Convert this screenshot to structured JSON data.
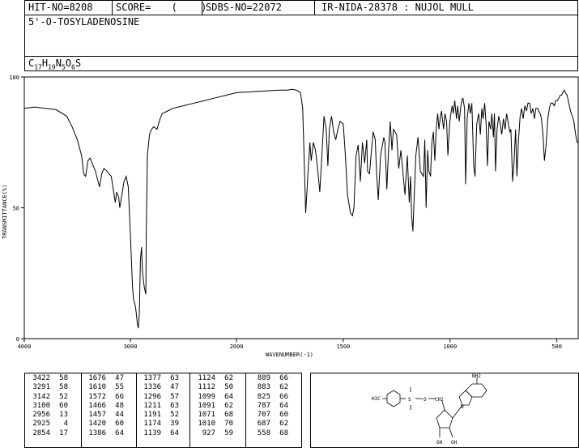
{
  "header": {
    "hit_no": "HIT-NO=8208",
    "score": "SCORE=  (  )",
    "sdbs_no": "SDBS-NO=22072",
    "ir_info": "IR-NIDA-28378 : NUJOL MULL",
    "compound_name": "5'-O-TOSYLADENOSINE",
    "formula": "C17H19N5O6S"
  },
  "chart_data": {
    "type": "line",
    "title": "",
    "xlabel": "WAVENUMBER(-1)",
    "ylabel": "TRANSMITTANCE(%)",
    "xlim": [
      4000,
      400
    ],
    "ylim": [
      0,
      100
    ],
    "x_ticks": [
      4000,
      3000,
      2000,
      1500,
      1000,
      500
    ],
    "y_ticks": [
      0,
      50,
      100
    ],
    "series": [
      {
        "points": [
          [
            4000,
            88
          ],
          [
            3900,
            88.5
          ],
          [
            3800,
            88
          ],
          [
            3700,
            87.5
          ],
          [
            3600,
            85
          ],
          [
            3550,
            81
          ],
          [
            3500,
            76
          ],
          [
            3460,
            70
          ],
          [
            3440,
            63
          ],
          [
            3422,
            62
          ],
          [
            3400,
            68
          ],
          [
            3380,
            69
          ],
          [
            3360,
            67
          ],
          [
            3330,
            64
          ],
          [
            3291,
            58
          ],
          [
            3270,
            63
          ],
          [
            3250,
            65
          ],
          [
            3220,
            64
          ],
          [
            3180,
            62
          ],
          [
            3142,
            52
          ],
          [
            3130,
            56
          ],
          [
            3110,
            54
          ],
          [
            3100,
            50
          ],
          [
            3080,
            55
          ],
          [
            3060,
            60
          ],
          [
            3040,
            62
          ],
          [
            3020,
            58
          ],
          [
            3000,
            40
          ],
          [
            2980,
            20
          ],
          [
            2970,
            15
          ],
          [
            2956,
            13
          ],
          [
            2945,
            10
          ],
          [
            2935,
            6
          ],
          [
            2925,
            4
          ],
          [
            2915,
            10
          ],
          [
            2905,
            30
          ],
          [
            2895,
            35
          ],
          [
            2885,
            25
          ],
          [
            2870,
            20
          ],
          [
            2860,
            18
          ],
          [
            2854,
            17
          ],
          [
            2850,
            40
          ],
          [
            2840,
            70
          ],
          [
            2820,
            78
          ],
          [
            2800,
            80
          ],
          [
            2780,
            81
          ],
          [
            2750,
            80
          ],
          [
            2720,
            84
          ],
          [
            2700,
            86
          ],
          [
            2650,
            87
          ],
          [
            2600,
            88
          ],
          [
            2500,
            89
          ],
          [
            2400,
            90
          ],
          [
            2300,
            91
          ],
          [
            2200,
            92
          ],
          [
            2100,
            93
          ],
          [
            2000,
            94
          ],
          [
            1900,
            94.5
          ],
          [
            1800,
            95
          ],
          [
            1760,
            95
          ],
          [
            1740,
            95.3
          ],
          [
            1720,
            95
          ],
          [
            1700,
            94
          ],
          [
            1690,
            88
          ],
          [
            1676,
            48
          ],
          [
            1666,
            62
          ],
          [
            1656,
            75
          ],
          [
            1650,
            68
          ],
          [
            1640,
            75
          ],
          [
            1630,
            72
          ],
          [
            1620,
            65
          ],
          [
            1610,
            56
          ],
          [
            1600,
            70
          ],
          [
            1590,
            85
          ],
          [
            1580,
            80
          ],
          [
            1572,
            66
          ],
          [
            1565,
            80
          ],
          [
            1555,
            85
          ],
          [
            1545,
            79
          ],
          [
            1535,
            76
          ],
          [
            1525,
            80
          ],
          [
            1515,
            83
          ],
          [
            1500,
            82
          ],
          [
            1490,
            70
          ],
          [
            1480,
            55
          ],
          [
            1466,
            48
          ],
          [
            1457,
            47
          ],
          [
            1450,
            50
          ],
          [
            1440,
            70
          ],
          [
            1430,
            74
          ],
          [
            1420,
            60
          ],
          [
            1410,
            75
          ],
          [
            1400,
            67
          ],
          [
            1390,
            76
          ],
          [
            1386,
            64
          ],
          [
            1377,
            63
          ],
          [
            1370,
            70
          ],
          [
            1360,
            79
          ],
          [
            1350,
            76
          ],
          [
            1345,
            65
          ],
          [
            1336,
            53
          ],
          [
            1325,
            70
          ],
          [
            1310,
            77
          ],
          [
            1305,
            75
          ],
          [
            1296,
            57
          ],
          [
            1288,
            72
          ],
          [
            1280,
            83
          ],
          [
            1272,
            72
          ],
          [
            1265,
            80
          ],
          [
            1250,
            78
          ],
          [
            1240,
            65
          ],
          [
            1230,
            72
          ],
          [
            1220,
            63
          ],
          [
            1211,
            55
          ],
          [
            1200,
            70
          ],
          [
            1191,
            52
          ],
          [
            1185,
            62
          ],
          [
            1180,
            47
          ],
          [
            1174,
            41
          ],
          [
            1165,
            60
          ],
          [
            1160,
            70
          ],
          [
            1150,
            77
          ],
          [
            1139,
            64
          ],
          [
            1124,
            62
          ],
          [
            1118,
            76
          ],
          [
            1112,
            50
          ],
          [
            1105,
            72
          ],
          [
            1099,
            64
          ],
          [
            1091,
            62
          ],
          [
            1085,
            75
          ],
          [
            1078,
            79
          ],
          [
            1071,
            68
          ],
          [
            1065,
            80
          ],
          [
            1058,
            86
          ],
          [
            1052,
            80
          ],
          [
            1045,
            85
          ],
          [
            1040,
            87
          ],
          [
            1030,
            80
          ],
          [
            1024,
            86
          ],
          [
            1016,
            83
          ],
          [
            1010,
            70
          ],
          [
            1002,
            82
          ],
          [
            996,
            86
          ],
          [
            990,
            89
          ],
          [
            985,
            86
          ],
          [
            978,
            91
          ],
          [
            970,
            84
          ],
          [
            964,
            89
          ],
          [
            957,
            83
          ],
          [
            948,
            90
          ],
          [
            940,
            92
          ],
          [
            932,
            88
          ],
          [
            927,
            59
          ],
          [
            920,
            84
          ],
          [
            912,
            90
          ],
          [
            905,
            86
          ],
          [
            898,
            90
          ],
          [
            889,
            66
          ],
          [
            883,
            62
          ],
          [
            875,
            82
          ],
          [
            866,
            86
          ],
          [
            858,
            78
          ],
          [
            851,
            88
          ],
          [
            845,
            84
          ],
          [
            838,
            90
          ],
          [
            831,
            82
          ],
          [
            825,
            66
          ],
          [
            818,
            83
          ],
          [
            810,
            80
          ],
          [
            804,
            86
          ],
          [
            797,
            77
          ],
          [
            792,
            86
          ],
          [
            787,
            64
          ],
          [
            780,
            80
          ],
          [
            772,
            85
          ],
          [
            765,
            82
          ],
          [
            758,
            78
          ],
          [
            750,
            84
          ],
          [
            742,
            80
          ],
          [
            735,
            86
          ],
          [
            727,
            82
          ],
          [
            720,
            79
          ],
          [
            715,
            80
          ],
          [
            707,
            60
          ],
          [
            700,
            68
          ],
          [
            693,
            80
          ],
          [
            687,
            62
          ],
          [
            680,
            75
          ],
          [
            672,
            85
          ],
          [
            665,
            88
          ],
          [
            658,
            84
          ],
          [
            650,
            89
          ],
          [
            642,
            87
          ],
          [
            635,
            90
          ],
          [
            627,
            90
          ],
          [
            620,
            86
          ],
          [
            612,
            88
          ],
          [
            605,
            84
          ],
          [
            598,
            88
          ],
          [
            590,
            88
          ],
          [
            585,
            87
          ],
          [
            578,
            86
          ],
          [
            572,
            84
          ],
          [
            565,
            78
          ],
          [
            558,
            68
          ],
          [
            550,
            74
          ],
          [
            542,
            84
          ],
          [
            535,
            88
          ],
          [
            528,
            90
          ],
          [
            520,
            90
          ],
          [
            512,
            89
          ],
          [
            505,
            91
          ],
          [
            498,
            91
          ],
          [
            490,
            92
          ],
          [
            484,
            93
          ],
          [
            478,
            93
          ],
          [
            472,
            94
          ],
          [
            466,
            95
          ],
          [
            460,
            94
          ],
          [
            452,
            93
          ],
          [
            444,
            90
          ],
          [
            436,
            87
          ],
          [
            428,
            85
          ],
          [
            420,
            83
          ],
          [
            412,
            78
          ],
          [
            405,
            75
          ],
          [
            400,
            75
          ]
        ]
      }
    ]
  },
  "peak_table": {
    "columns": [
      [
        [
          "3422",
          "58"
        ],
        [
          "3291",
          "58"
        ],
        [
          "3142",
          "52"
        ],
        [
          "3100",
          "60"
        ],
        [
          "2956",
          "13"
        ],
        [
          "2925",
          "4"
        ],
        [
          "2854",
          "17"
        ]
      ],
      [
        [
          "1676",
          "47"
        ],
        [
          "1610",
          "55"
        ],
        [
          "1572",
          "66"
        ],
        [
          "1466",
          "48"
        ],
        [
          "1457",
          "44"
        ],
        [
          "1420",
          "60"
        ],
        [
          "1386",
          "64"
        ]
      ],
      [
        [
          "1377",
          "63"
        ],
        [
          "1336",
          "47"
        ],
        [
          "1296",
          "57"
        ],
        [
          "1211",
          "63"
        ],
        [
          "1191",
          "52"
        ],
        [
          "1174",
          "39"
        ],
        [
          "1139",
          "64"
        ]
      ],
      [
        [
          "1124",
          "62"
        ],
        [
          "1112",
          "50"
        ],
        [
          "1099",
          "64"
        ],
        [
          "1091",
          "62"
        ],
        [
          "1071",
          "68"
        ],
        [
          "1010",
          "70"
        ],
        [
          "927",
          "59"
        ]
      ],
      [
        [
          "889",
          "66"
        ],
        [
          "883",
          "62"
        ],
        [
          "825",
          "66"
        ],
        [
          "787",
          "64"
        ],
        [
          "707",
          "60"
        ],
        [
          "687",
          "62"
        ],
        [
          "558",
          "68"
        ]
      ]
    ]
  },
  "structure": {
    "labels": [
      "NH2",
      "H3C",
      "O",
      "S",
      "CH2",
      "OH",
      "OH",
      "N"
    ]
  }
}
